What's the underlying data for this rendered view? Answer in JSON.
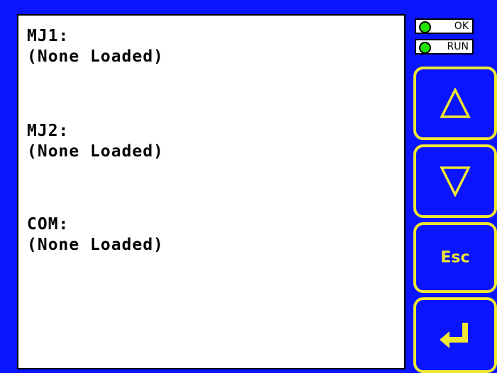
{
  "display": {
    "background_color": "#0a14ff",
    "button_border_color": "#f0e830",
    "led_color": "#22e000",
    "entries": [
      {
        "label": "MJ1:",
        "value": "(None Loaded)"
      },
      {
        "label": "MJ2:",
        "value": "(None Loaded)"
      },
      {
        "label": "COM:",
        "value": "(None Loaded)"
      }
    ]
  },
  "status": {
    "ok_label": "OK",
    "run_label": "RUN"
  },
  "buttons": {
    "up_icon": "up-triangle-icon",
    "down_icon": "down-triangle-icon",
    "esc_label": "Esc",
    "enter_icon": "enter-arrow-icon"
  }
}
